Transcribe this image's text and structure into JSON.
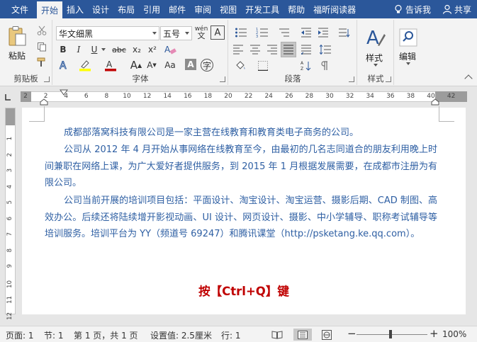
{
  "ribbon_tabs": [
    "文件",
    "开始",
    "插入",
    "设计",
    "布局",
    "引用",
    "邮件",
    "审阅",
    "视图",
    "开发工具",
    "帮助",
    "福昕阅读器"
  ],
  "active_tab": "开始",
  "tell_me": "告诉我",
  "share": "共享",
  "clipboard": {
    "paste": "粘贴",
    "group": "剪贴板"
  },
  "font": {
    "name": "华文细黑",
    "size": "五号",
    "phonetic": "wén",
    "bold": "B",
    "italic": "I",
    "underline": "U",
    "strike": "abc",
    "subscript": "x₂",
    "superscript": "x²",
    "grow": "A",
    "shrink": "A",
    "case": "Aa",
    "group": "字体"
  },
  "paragraph": {
    "group": "段落"
  },
  "styles": {
    "label": "样式",
    "group": "样式"
  },
  "editing": {
    "label": "编辑"
  },
  "ruler": {
    "ticks": [
      "2",
      "2",
      "4",
      "6",
      "8",
      "10",
      "12",
      "14",
      "16",
      "18",
      "20",
      "22",
      "24",
      "26",
      "28",
      "30",
      "32",
      "34",
      "36",
      "38",
      "40",
      "42"
    ],
    "vticks": [
      "1",
      "2",
      "3",
      "4",
      "5",
      "6",
      "7",
      "8",
      "9",
      "10",
      "11",
      "12"
    ]
  },
  "document": {
    "paragraphs": [
      "成都部落窝科技有限公司是一家主营在线教育和教育类电子商务的公司。",
      "公司从 2012 年 4 月开始从事网络在线教育至今，由最初的几名志同道合的朋友利用晚上时间兼职在网络上课，为广大爱好者提供服务，到 2015 年 1 月根据发展需要，在成都市注册为有限公司。",
      "公司当前开展的培训项目包括：平面设计、淘宝设计、淘宝运营、摄影后期、CAD 制图、高效办公。后续还将陆续增开影视动画、UI 设计、网页设计、摄影、中小学辅导、职称考试辅导等培训服务。培训平台为 YY（频道号 69247）和腾讯课堂（http://psketang.ke.qq.com）。"
    ],
    "hint": "按【Ctrl+Q】键"
  },
  "status": {
    "page": "页面: 1",
    "section": "节: 1",
    "page_of": "第 1 页，共 1 页",
    "setting": "设置值: 2.5厘米",
    "line": "行: 1",
    "zoom": "100%",
    "zoom_level": 1.0
  }
}
